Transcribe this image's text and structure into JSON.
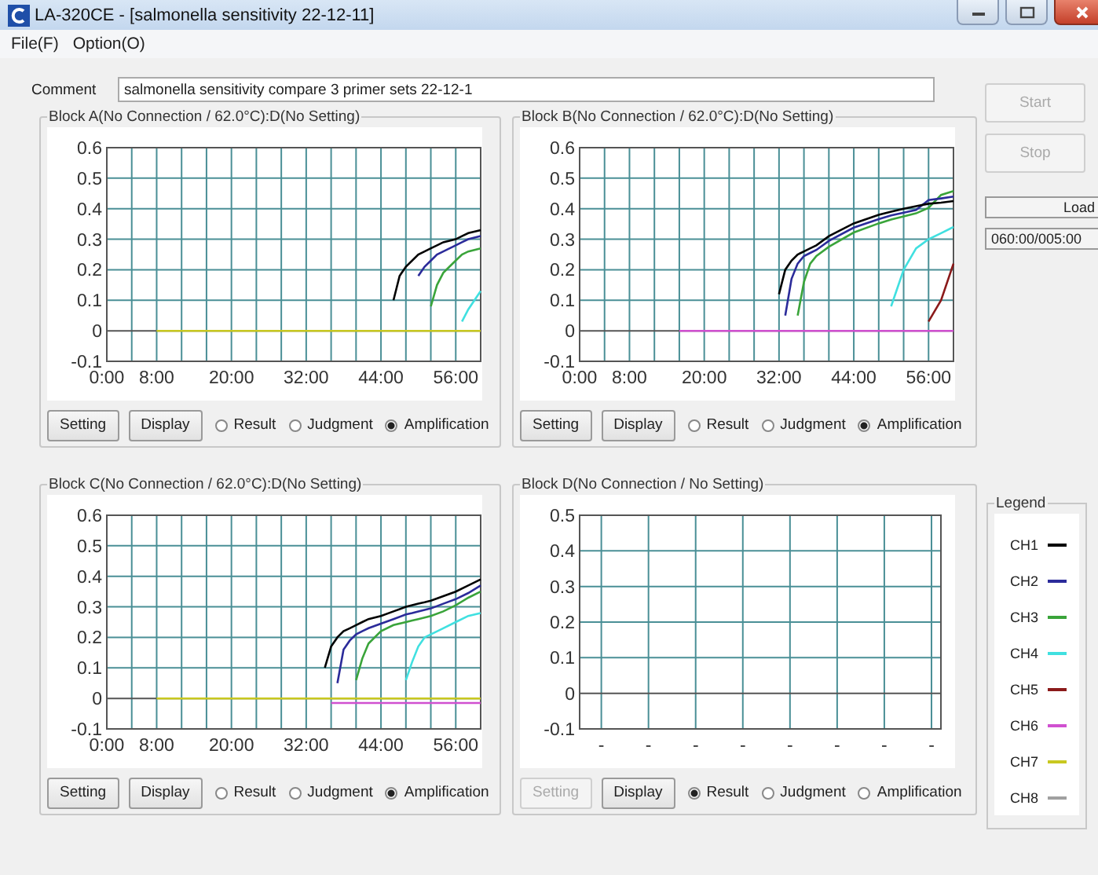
{
  "window": {
    "title": "LA-320CE - [salmonella sensitivity 22-12-11]"
  },
  "menu": [
    "File(F)",
    "Option(O)"
  ],
  "comment": {
    "label": "Comment",
    "value": "salmonella sensitivity compare 3 primer sets 22-12-1"
  },
  "run_controls": [
    {
      "label": "Start",
      "disabled": true
    },
    {
      "label": "Stop",
      "disabled": true
    }
  ],
  "status": {
    "state": "Load",
    "time": "060:00/005:00"
  },
  "blocks": [
    {
      "title": "Block A(No Connection / 62.0°C):D(No Setting)",
      "chart_data": {
        "type": "line",
        "grid": true,
        "x": [
          8,
          16,
          24,
          32,
          40,
          44,
          45,
          46,
          47,
          48,
          50,
          51,
          52,
          53,
          54,
          56,
          57,
          58,
          60
        ],
        "xlim": [
          0,
          60
        ],
        "ylim": [
          -0.1,
          0.6
        ],
        "xticks": [
          {
            "value": 0,
            "label": "0:00"
          },
          {
            "value": 8,
            "label": "8:00"
          },
          {
            "value": 20,
            "label": "20:00"
          },
          {
            "value": 32,
            "label": "32:00"
          },
          {
            "value": 44,
            "label": "44:00"
          },
          {
            "value": 56,
            "label": "56:00"
          }
        ],
        "yticks": [
          -0.1,
          0,
          0.1,
          0.2,
          0.3,
          0.4,
          0.5,
          0.6
        ],
        "series": [
          {
            "color": "#000000",
            "values": [
              null,
              null,
              null,
              null,
              null,
              null,
              null,
              0.1,
              0.18,
              0.21,
              0.25,
              0.26,
              0.27,
              0.28,
              0.29,
              0.3,
              0.31,
              0.32,
              0.33
            ]
          },
          {
            "color": "#2b2b9a",
            "values": [
              null,
              null,
              null,
              null,
              null,
              null,
              null,
              null,
              null,
              null,
              0.18,
              0.21,
              0.23,
              0.25,
              0.26,
              0.28,
              0.29,
              0.3,
              0.31
            ]
          },
          {
            "color": "#3aa43a",
            "values": [
              null,
              null,
              null,
              null,
              null,
              null,
              null,
              null,
              null,
              null,
              null,
              null,
              0.08,
              0.15,
              0.19,
              0.23,
              0.25,
              0.26,
              0.27
            ]
          },
          {
            "color": "#40e0e0",
            "values": [
              null,
              null,
              null,
              null,
              null,
              null,
              null,
              null,
              null,
              null,
              null,
              null,
              null,
              null,
              null,
              null,
              0.03,
              0.07,
              0.13
            ]
          },
          {
            "color": "#c8c820",
            "values": [
              0,
              0,
              0,
              0,
              0,
              0,
              0,
              0,
              0,
              0,
              0,
              0,
              0,
              0,
              0,
              0,
              0,
              0,
              0
            ]
          }
        ]
      },
      "buttons": [
        {
          "label": "Setting",
          "disabled": false
        },
        {
          "label": "Display",
          "disabled": false
        }
      ],
      "views": [
        {
          "label": "Result",
          "selected": false
        },
        {
          "label": "Judgment",
          "selected": false
        },
        {
          "label": "Amplification",
          "selected": true
        }
      ]
    },
    {
      "title": "Block B(No Connection / 62.0°C):D(No Setting)",
      "chart_data": {
        "type": "line",
        "grid": true,
        "x": [
          16,
          24,
          30,
          32,
          33,
          34,
          35,
          36,
          37,
          38,
          40,
          44,
          48,
          50,
          52,
          54,
          56,
          58,
          60
        ],
        "xlim": [
          0,
          60
        ],
        "ylim": [
          -0.1,
          0.6
        ],
        "xticks": [
          {
            "value": 0,
            "label": "0:00"
          },
          {
            "value": 8,
            "label": "8:00"
          },
          {
            "value": 20,
            "label": "20:00"
          },
          {
            "value": 32,
            "label": "32:00"
          },
          {
            "value": 44,
            "label": "44:00"
          },
          {
            "value": 56,
            "label": "56:00"
          }
        ],
        "yticks": [
          -0.1,
          0,
          0.1,
          0.2,
          0.3,
          0.4,
          0.5,
          0.6
        ],
        "series": [
          {
            "color": "#8b1a1a",
            "values": [
              null,
              null,
              null,
              null,
              null,
              null,
              null,
              null,
              null,
              null,
              null,
              null,
              null,
              null,
              null,
              null,
              0.03,
              0.1,
              0.22
            ]
          },
          {
            "color": "#40e0e0",
            "values": [
              null,
              null,
              null,
              null,
              null,
              null,
              null,
              null,
              null,
              null,
              null,
              null,
              null,
              0.08,
              0.2,
              0.27,
              0.3,
              0.32,
              0.34
            ]
          },
          {
            "color": "#3aa43a",
            "values": [
              null,
              null,
              null,
              null,
              null,
              null,
              0.05,
              0.16,
              0.22,
              0.245,
              0.275,
              0.322,
              0.352,
              0.365,
              0.375,
              0.385,
              0.403,
              0.445,
              0.458
            ]
          },
          {
            "color": "#2b2b9a",
            "values": [
              null,
              null,
              null,
              null,
              0.05,
              0.17,
              0.22,
              0.245,
              0.255,
              0.265,
              0.295,
              0.338,
              0.366,
              0.378,
              0.387,
              0.396,
              0.428,
              0.434,
              0.44
            ]
          },
          {
            "color": "#000000",
            "values": [
              null,
              null,
              null,
              0.12,
              0.2,
              0.23,
              0.25,
              0.26,
              0.27,
              0.28,
              0.31,
              0.352,
              0.38,
              0.39,
              0.4,
              0.408,
              0.416,
              0.42,
              0.425
            ]
          },
          {
            "color": "#d050d0",
            "values": [
              0,
              0,
              0,
              0,
              0,
              0,
              0,
              0,
              0,
              0,
              0,
              0,
              0,
              0,
              0,
              0,
              0,
              0,
              0
            ]
          }
        ]
      },
      "buttons": [
        {
          "label": "Setting",
          "disabled": false
        },
        {
          "label": "Display",
          "disabled": false
        }
      ],
      "views": [
        {
          "label": "Result",
          "selected": false
        },
        {
          "label": "Judgment",
          "selected": false
        },
        {
          "label": "Amplification",
          "selected": true
        }
      ]
    },
    {
      "title": "Block C(No Connection / 62.0°C):D(No Setting)",
      "chart_data": {
        "type": "line",
        "grid": true,
        "x": [
          8,
          16,
          24,
          32,
          35,
          36,
          37,
          38,
          39,
          40,
          41,
          42,
          44,
          46,
          48,
          49,
          50,
          51,
          52,
          54,
          56,
          58,
          60
        ],
        "xlim": [
          0,
          60
        ],
        "ylim": [
          -0.1,
          0.6
        ],
        "xticks": [
          {
            "value": 0,
            "label": "0:00"
          },
          {
            "value": 8,
            "label": "8:00"
          },
          {
            "value": 20,
            "label": "20:00"
          },
          {
            "value": 32,
            "label": "32:00"
          },
          {
            "value": 44,
            "label": "44:00"
          },
          {
            "value": 56,
            "label": "56:00"
          }
        ],
        "yticks": [
          -0.1,
          0,
          0.1,
          0.2,
          0.3,
          0.4,
          0.5,
          0.6
        ],
        "series": [
          {
            "color": "#d050d0",
            "values": [
              null,
              null,
              null,
              null,
              null,
              -0.015,
              -0.015,
              -0.015,
              -0.015,
              -0.015,
              -0.015,
              -0.015,
              -0.015,
              -0.015,
              -0.015,
              -0.015,
              -0.015,
              -0.015,
              -0.015,
              -0.015,
              -0.015,
              -0.015,
              -0.015
            ]
          },
          {
            "color": "#000000",
            "values": [
              null,
              null,
              null,
              null,
              0.1,
              0.17,
              0.2,
              0.22,
              0.23,
              0.24,
              0.25,
              0.26,
              0.27,
              0.285,
              0.3,
              0.305,
              0.31,
              0.315,
              0.32,
              0.335,
              0.35,
              0.37,
              0.39
            ]
          },
          {
            "color": "#2b2b9a",
            "values": [
              null,
              null,
              null,
              null,
              null,
              null,
              0.05,
              0.16,
              0.19,
              0.21,
              0.22,
              0.23,
              0.245,
              0.26,
              0.275,
              0.28,
              0.285,
              0.29,
              0.295,
              0.31,
              0.325,
              0.345,
              0.37
            ]
          },
          {
            "color": "#3aa43a",
            "values": [
              null,
              null,
              null,
              null,
              null,
              null,
              null,
              null,
              null,
              0.06,
              0.13,
              0.18,
              0.22,
              0.24,
              0.25,
              0.255,
              0.26,
              0.265,
              0.27,
              0.285,
              0.305,
              0.33,
              0.35
            ]
          },
          {
            "color": "#40e0e0",
            "values": [
              null,
              null,
              null,
              null,
              null,
              null,
              null,
              null,
              null,
              null,
              null,
              null,
              null,
              null,
              0.06,
              0.12,
              0.17,
              0.2,
              0.21,
              0.23,
              0.25,
              0.27,
              0.28
            ]
          },
          {
            "color": "#c8c820",
            "values": [
              0,
              0,
              0,
              0,
              0,
              0,
              0,
              0,
              0,
              0,
              0,
              0,
              0,
              0,
              0,
              0,
              0,
              0,
              0,
              0,
              0,
              0,
              0
            ]
          }
        ]
      },
      "buttons": [
        {
          "label": "Setting",
          "disabled": false
        },
        {
          "label": "Display",
          "disabled": false
        }
      ],
      "views": [
        {
          "label": "Result",
          "selected": false
        },
        {
          "label": "Judgment",
          "selected": false
        },
        {
          "label": "Amplification",
          "selected": true
        }
      ]
    },
    {
      "title": "Block D(No Connection / No Setting)",
      "chart_data": {
        "type": "line",
        "grid": true,
        "categories": [
          "-",
          "-",
          "-",
          "-",
          "-",
          "-",
          "-",
          "-"
        ],
        "ylim": [
          -0.1,
          0.5
        ],
        "yticks": [
          -0.1,
          0,
          0.1,
          0.2,
          0.3,
          0.4,
          0.5
        ]
      },
      "buttons": [
        {
          "label": "Setting",
          "disabled": true
        },
        {
          "label": "Display",
          "disabled": false
        }
      ],
      "views": [
        {
          "label": "Result",
          "selected": true
        },
        {
          "label": "Judgment",
          "selected": false
        },
        {
          "label": "Amplification",
          "selected": false
        }
      ]
    }
  ],
  "legend": {
    "title": "Legend",
    "items": [
      {
        "label": "CH1",
        "color": "#000000"
      },
      {
        "label": "CH2",
        "color": "#2b2b9a"
      },
      {
        "label": "CH3",
        "color": "#3aa43a"
      },
      {
        "label": "CH4",
        "color": "#40e0e0"
      },
      {
        "label": "CH5",
        "color": "#8b1a1a"
      },
      {
        "label": "CH6",
        "color": "#d050d0"
      },
      {
        "label": "CH7",
        "color": "#c8c820"
      },
      {
        "label": "CH8",
        "color": "#a0a0a0"
      }
    ]
  }
}
